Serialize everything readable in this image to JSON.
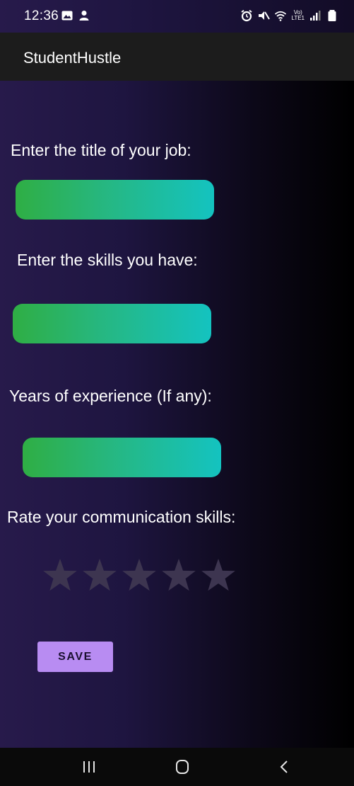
{
  "status_bar": {
    "time": "12:36",
    "left_icons": [
      "gallery-icon",
      "notification-person-icon"
    ],
    "right_icons": [
      "alarm-icon",
      "mute-icon",
      "wifi-icon",
      "volte-lte-icon",
      "signal-icon",
      "battery-icon"
    ],
    "lte_top": "Vo)",
    "lte_bottom": "LTE1"
  },
  "app_bar": {
    "title": "StudentHustle"
  },
  "form": {
    "job_title_label": "Enter the title of your job:",
    "job_title_value": "",
    "skills_label": "Enter the skills you have:",
    "skills_value": "",
    "experience_label": "Years of experience (If any):",
    "experience_value": "",
    "rating_label": "Rate your communication skills:",
    "rating": {
      "value": 0,
      "max": 5
    },
    "save_label": "SAVE"
  },
  "nav_bar": {
    "buttons": [
      "recent-apps-icon",
      "home-icon",
      "back-icon"
    ]
  },
  "colors": {
    "background_left": "#271a4b",
    "background_right": "#000000",
    "input_gradient_start": "#2fae44",
    "input_gradient_end": "#14c3c0",
    "star_empty": "#3d3550",
    "button": "#b88cf2"
  }
}
